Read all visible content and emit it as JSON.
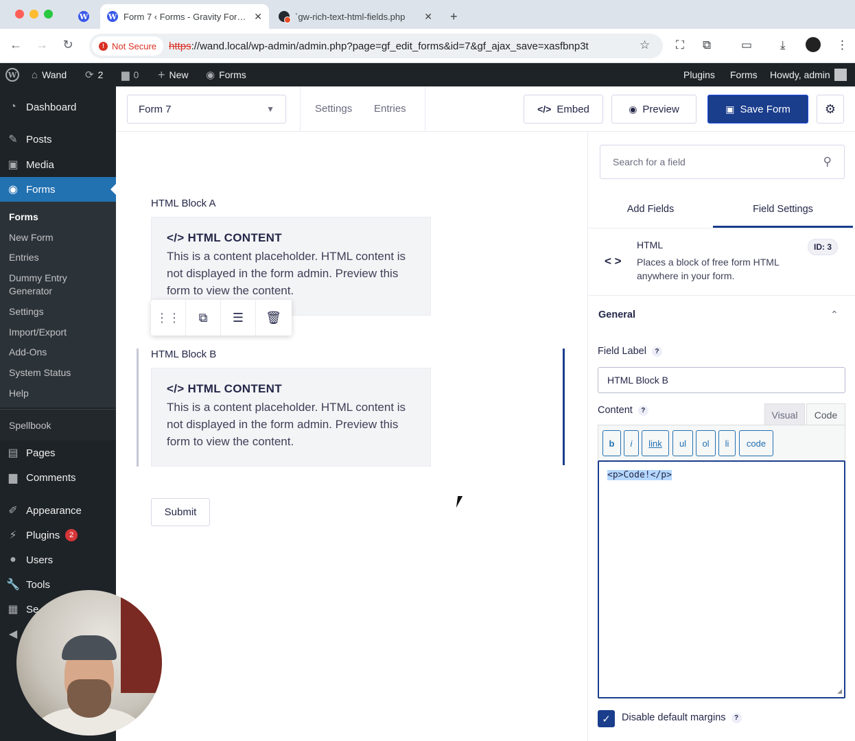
{
  "browser": {
    "tabs": [
      {
        "title": "Form 7 ‹ Forms - Gravity Forms",
        "active": true
      },
      {
        "title": "`gw-rich-text-html-fields.php",
        "active": false
      }
    ],
    "new_tab": "+",
    "security": "Not Secure",
    "url_scheme": "https",
    "url_rest": "://wand.local/wp-admin/admin.php?page=gf_edit_forms&id=7&gf_ajax_save=xasfbnp3t"
  },
  "admin_bar": {
    "site_name": "Wand",
    "updates_count": "2",
    "comments_count": "0",
    "new_label": "New",
    "forms_label": "Forms",
    "right_plugins": "Plugins",
    "right_forms": "Forms",
    "howdy": "Howdy, admin"
  },
  "admin_menu": {
    "dashboard": "Dashboard",
    "posts": "Posts",
    "media": "Media",
    "forms": "Forms",
    "submenu": [
      "Forms",
      "New Form",
      "Entries",
      "Dummy Entry Generator",
      "Settings",
      "Import/Export",
      "Add-Ons",
      "System Status",
      "Help"
    ],
    "spellbook": "Spellbook",
    "pages": "Pages",
    "comments": "Comments",
    "appearance": "Appearance",
    "plugins": "Plugins",
    "plugins_badge": "2",
    "users": "Users",
    "tools": "Tools",
    "settings_partial": "Se"
  },
  "gf_toolbar": {
    "form_name": "Form 7",
    "settings": "Settings",
    "entries": "Entries",
    "embed": "Embed",
    "preview": "Preview",
    "save": "Save Form"
  },
  "canvas": {
    "block_a_label": "HTML Block A",
    "block_b_label": "HTML Block B",
    "html_title": "HTML CONTENT",
    "html_text": "This is a content placeholder. HTML content is not displayed in the form admin. Preview this form to view the content.",
    "submit": "Submit"
  },
  "sidebar": {
    "search_placeholder": "Search for a field",
    "tab_add": "Add Fields",
    "tab_settings": "Field Settings",
    "field_type": "HTML",
    "field_desc": "Places a block of free form HTML anywhere in your form.",
    "field_id": "ID: 3",
    "section": "General",
    "field_label_title": "Field Label",
    "field_label_value": "HTML Block B",
    "content_title": "Content",
    "editor_visual": "Visual",
    "editor_code": "Code",
    "quicktags": [
      "b",
      "i",
      "link",
      "ul",
      "ol",
      "li",
      "code"
    ],
    "content_value": "<p>Code!</p>",
    "disable_margins": "Disable default margins",
    "help": "?"
  },
  "colors": {
    "wp_menu_bg": "#1d2327",
    "wp_current": "#2271b1",
    "gf_primary": "#1a3d8c",
    "badge_red": "#d63638"
  }
}
